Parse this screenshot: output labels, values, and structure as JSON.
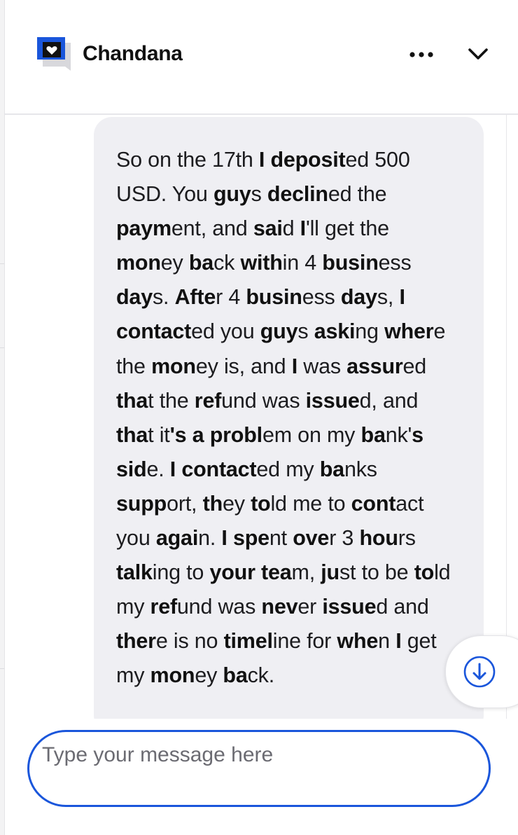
{
  "header": {
    "title": "Chandana",
    "more_icon": "more-horizontal-icon",
    "collapse_icon": "chevron-down-icon"
  },
  "message": {
    "lines": [
      [
        [
          "So on the 17th ",
          false
        ],
        [
          "I deposit",
          true
        ],
        [
          "ed 500",
          false
        ]
      ],
      [
        [
          "USD. You ",
          false
        ],
        [
          "guy",
          true
        ],
        [
          "s ",
          false
        ],
        [
          "declin",
          true
        ],
        [
          "ed the",
          false
        ]
      ],
      [
        [
          "paym",
          true
        ],
        [
          "ent, and ",
          false
        ],
        [
          "sai",
          true
        ],
        [
          "d ",
          false
        ],
        [
          "I",
          true
        ],
        [
          "'ll get the",
          false
        ]
      ],
      [
        [
          "mon",
          true
        ],
        [
          "ey ",
          false
        ],
        [
          "ba",
          true
        ],
        [
          "ck ",
          false
        ],
        [
          "with",
          true
        ],
        [
          "in 4 ",
          false
        ],
        [
          "busin",
          true
        ],
        [
          "ess",
          false
        ]
      ],
      [
        [
          "day",
          true
        ],
        [
          "s. ",
          false
        ],
        [
          "Afte",
          true
        ],
        [
          "r 4 ",
          false
        ],
        [
          "busin",
          true
        ],
        [
          "ess ",
          false
        ],
        [
          "day",
          true
        ],
        [
          "s, ",
          false
        ],
        [
          "I",
          true
        ]
      ],
      [
        [
          "contact",
          true
        ],
        [
          "ed you ",
          false
        ],
        [
          "guy",
          true
        ],
        [
          "s ",
          false
        ],
        [
          "aski",
          true
        ],
        [
          "ng ",
          false
        ],
        [
          "wher",
          true
        ],
        [
          "e",
          false
        ]
      ],
      [
        [
          "the ",
          false
        ],
        [
          "mon",
          true
        ],
        [
          "ey is, and ",
          false
        ],
        [
          "I",
          true
        ],
        [
          " was ",
          false
        ],
        [
          "assur",
          true
        ],
        [
          "ed",
          false
        ]
      ],
      [
        [
          "tha",
          true
        ],
        [
          "t the ",
          false
        ],
        [
          "ref",
          true
        ],
        [
          "und was ",
          false
        ],
        [
          "issue",
          true
        ],
        [
          "d, and",
          false
        ]
      ],
      [
        [
          "tha",
          true
        ],
        [
          "t it",
          false
        ],
        [
          "'s a probl",
          true
        ],
        [
          "em on my ",
          false
        ],
        [
          "ba",
          true
        ],
        [
          "nk'",
          false
        ],
        [
          "s",
          true
        ]
      ],
      [
        [
          "sid",
          true
        ],
        [
          "e. ",
          false
        ],
        [
          "I contact",
          true
        ],
        [
          "ed my ",
          false
        ],
        [
          "ba",
          true
        ],
        [
          "nks",
          false
        ]
      ],
      [
        [
          "supp",
          true
        ],
        [
          "ort, ",
          false
        ],
        [
          "th",
          true
        ],
        [
          "ey ",
          false
        ],
        [
          "to",
          true
        ],
        [
          "ld me to ",
          false
        ],
        [
          "cont",
          true
        ],
        [
          "act",
          false
        ]
      ],
      [
        [
          "you ",
          false
        ],
        [
          "agai",
          true
        ],
        [
          "n. ",
          false
        ],
        [
          "I spe",
          true
        ],
        [
          "nt ",
          false
        ],
        [
          "ove",
          true
        ],
        [
          "r 3 ",
          false
        ],
        [
          "hou",
          true
        ],
        [
          "rs",
          false
        ]
      ],
      [
        [
          "talk",
          true
        ],
        [
          "ing to ",
          false
        ],
        [
          "your",
          true
        ],
        [
          " ",
          false
        ],
        [
          "tea",
          true
        ],
        [
          "m, ",
          false
        ],
        [
          "ju",
          true
        ],
        [
          "st to be ",
          false
        ],
        [
          "to",
          true
        ],
        [
          "ld",
          false
        ]
      ],
      [
        [
          "my ",
          false
        ],
        [
          "ref",
          true
        ],
        [
          "und was ",
          false
        ],
        [
          "nev",
          true
        ],
        [
          "er ",
          false
        ],
        [
          "issue",
          true
        ],
        [
          "d and",
          false
        ]
      ],
      [
        [
          "ther",
          true
        ],
        [
          "e is no ",
          false
        ],
        [
          "timel",
          true
        ],
        [
          "ine for ",
          false
        ],
        [
          "whe",
          true
        ],
        [
          "n ",
          false
        ],
        [
          "I",
          true
        ],
        [
          " get",
          false
        ]
      ],
      [
        [
          "my ",
          false
        ],
        [
          "mon",
          true
        ],
        [
          "ey ",
          false
        ],
        [
          "ba",
          true
        ],
        [
          "ck.",
          false
        ]
      ]
    ]
  },
  "scroll_button": {
    "icon": "arrow-down-circle-icon",
    "color": "#1a56db"
  },
  "composer": {
    "placeholder": "Type your message here",
    "value": "",
    "border_color": "#1a56db"
  }
}
